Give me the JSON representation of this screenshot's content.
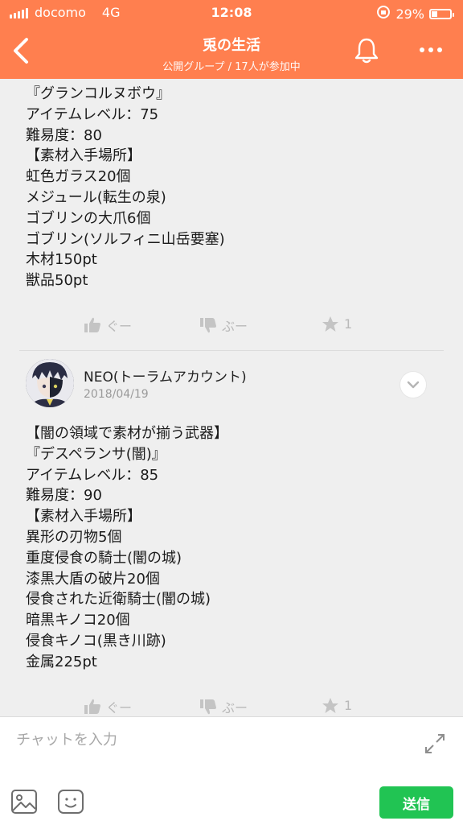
{
  "status_bar": {
    "carrier": "docomo",
    "network": "4G",
    "time": "12:08",
    "battery_percent": "29%",
    "battery_level": 0.29
  },
  "header": {
    "title": "兎の生活",
    "subtitle": "公開グループ / 17人が参加中"
  },
  "posts": [
    {
      "lines": [
        "『グランコルヌボウ』",
        "アイテムレベル：75",
        "難易度：80",
        "【素材入手場所】",
        "虹色ガラス20個",
        "メジュール(転生の泉)",
        "ゴブリンの大爪6個",
        "ゴブリン(ソルフィニ山岳要塞)",
        "木材150pt",
        "獣品50pt"
      ],
      "reactions": {
        "good": "ぐー",
        "bad": "ぶー",
        "star": "1"
      }
    },
    {
      "author": "NEO(トーラムアカウント)",
      "date": "2018/04/19",
      "lines": [
        "【闇の領域で素材が揃う武器】",
        "『デスペランサ(闇)』",
        "アイテムレベル：85",
        "難易度：90",
        "【素材入手場所】",
        "異形の刃物5個",
        "重度侵食の騎士(闇の城)",
        "漆黒大盾の破片20個",
        "侵食された近衛騎士(闇の城)",
        "暗黒キノコ20個",
        "侵食キノコ(黒き川跡)",
        "金属225pt"
      ],
      "reactions": {
        "good": "ぐー",
        "bad": "ぶー",
        "star": "1"
      }
    }
  ],
  "composer": {
    "placeholder": "チャットを入力",
    "send_label": "送信"
  },
  "colors": {
    "header_bg": "#ff7f4f",
    "send_bg": "#21c453"
  }
}
